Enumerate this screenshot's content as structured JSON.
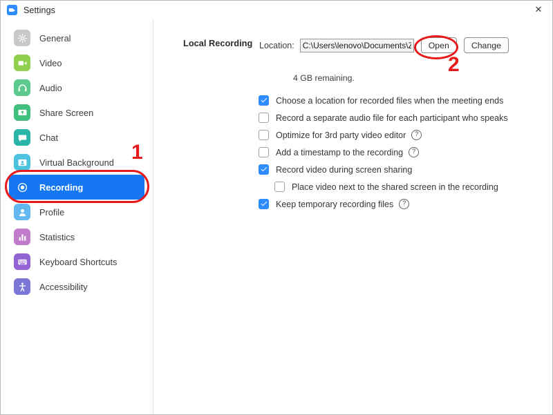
{
  "window": {
    "title": "Settings",
    "app_icon": "zoom-camera-icon",
    "close_label": "✕"
  },
  "sidebar": {
    "items": [
      {
        "label": "General",
        "icon": "gear-icon",
        "color": "#c8c8c8",
        "active": false
      },
      {
        "label": "Video",
        "icon": "video-camera-icon",
        "color": "#8fd14f",
        "active": false
      },
      {
        "label": "Audio",
        "icon": "headphones-icon",
        "color": "#5cc98f",
        "active": false
      },
      {
        "label": "Share Screen",
        "icon": "share-screen-icon",
        "color": "#41bf7f",
        "active": false
      },
      {
        "label": "Chat",
        "icon": "chat-bubble-icon",
        "color": "#2bb5a8",
        "active": false
      },
      {
        "label": "Virtual Background",
        "icon": "person-card-icon",
        "color": "#4ec3e0",
        "active": false
      },
      {
        "label": "Recording",
        "icon": "record-circle-icon",
        "color": "#1577f2",
        "active": true
      },
      {
        "label": "Profile",
        "icon": "person-icon",
        "color": "#63b8f0",
        "active": false
      },
      {
        "label": "Statistics",
        "icon": "bar-chart-icon",
        "color": "#c07ccb",
        "active": false
      },
      {
        "label": "Keyboard Shortcuts",
        "icon": "keyboard-icon",
        "color": "#9163d4",
        "active": false
      },
      {
        "label": "Accessibility",
        "icon": "accessibility-icon",
        "color": "#7b77d6",
        "active": false
      }
    ]
  },
  "main": {
    "section_title": "Local Recording",
    "location": {
      "label": "Location:",
      "value": "C:\\Users\\lenovo\\Documents\\Zoc",
      "placeholder": "Recording location",
      "open_button": "Open",
      "change_button": "Change",
      "storage_note": "4 GB remaining."
    },
    "options": [
      {
        "label": "Choose a location for recorded files when the meeting ends",
        "checked": true,
        "indent": false,
        "help": false
      },
      {
        "label": "Record a separate audio file for each participant who speaks",
        "checked": false,
        "indent": false,
        "help": false
      },
      {
        "label": "Optimize for 3rd party video editor",
        "checked": false,
        "indent": false,
        "help": true,
        "help_glyph": "?"
      },
      {
        "label": "Add a timestamp to the recording",
        "checked": false,
        "indent": false,
        "help": true,
        "help_glyph": "?"
      },
      {
        "label": "Record video during screen sharing",
        "checked": true,
        "indent": false,
        "help": false
      },
      {
        "label": "Place video next to the shared screen in the recording",
        "checked": false,
        "indent": true,
        "help": false
      },
      {
        "label": "Keep temporary recording files",
        "checked": true,
        "indent": false,
        "help": true,
        "help_glyph": "?"
      }
    ]
  },
  "annotations": {
    "color": "#e8191b",
    "marker_1": "1",
    "marker_2": "2",
    "marker_1_target": "sidebar-item-recording",
    "marker_2_target": "open-button"
  }
}
